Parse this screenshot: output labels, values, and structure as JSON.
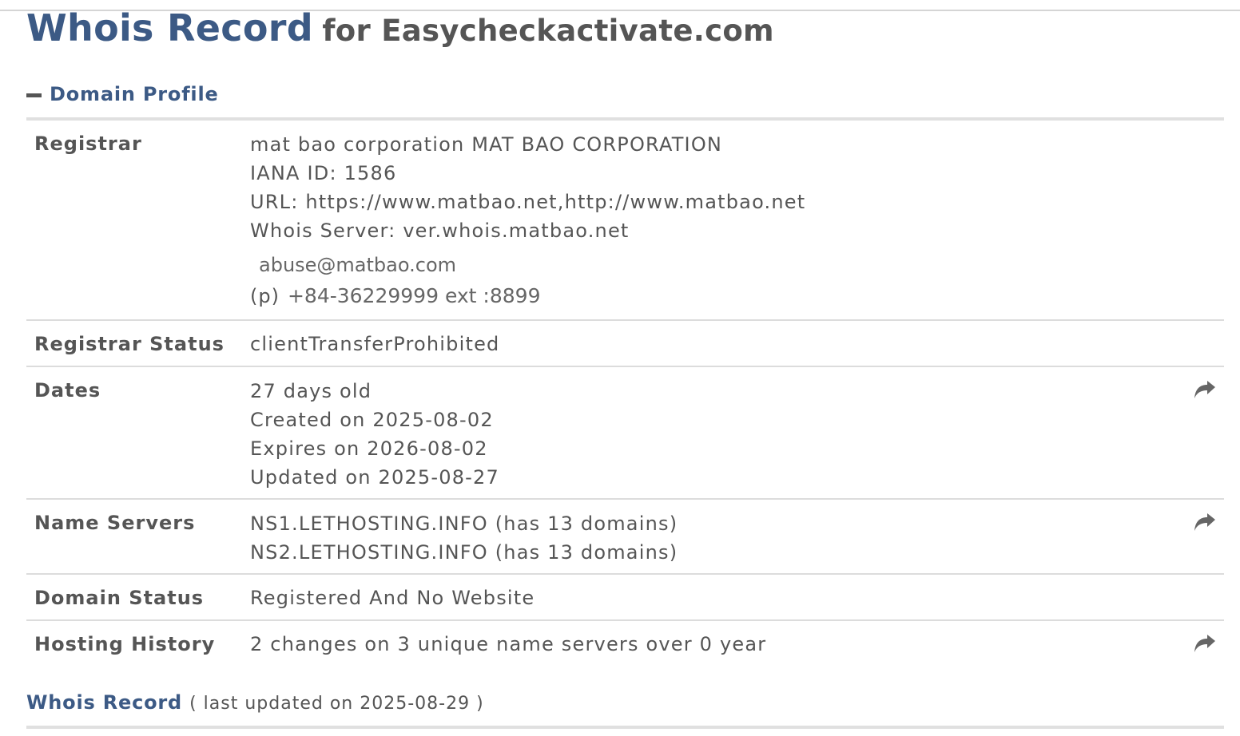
{
  "page": {
    "title_main": "Whois Record",
    "title_sub": "for Easycheckactivate.com"
  },
  "profile": {
    "section_title": "Domain Profile",
    "registrar": {
      "label": "Registrar",
      "name": "mat bao corporation MAT BAO CORPORATION",
      "iana": "IANA ID: 1586",
      "url": "URL: https://www.matbao.net,http://www.matbao.net",
      "whois_server": "Whois Server: ver.whois.matbao.net",
      "email": "abuse@matbao.com",
      "phone_label": "(p)",
      "phone": "+84-36229999 ext :8899"
    },
    "registrar_status": {
      "label": "Registrar Status",
      "value": "clientTransferProhibited"
    },
    "dates": {
      "label": "Dates",
      "age": "27 days old",
      "created": "Created on 2025-08-02",
      "expires": "Expires on 2026-08-02",
      "updated": "Updated on 2025-08-27"
    },
    "name_servers": {
      "label": "Name Servers",
      "ns1": "NS1.LETHOSTING.INFO (has 13 domains)",
      "ns2": "NS2.LETHOSTING.INFO (has 13 domains)"
    },
    "domain_status": {
      "label": "Domain Status",
      "value": "Registered And No Website"
    },
    "hosting_history": {
      "label": "Hosting History",
      "value": "2 changes on 3 unique name servers over 0 year"
    }
  },
  "whois_record": {
    "title": "Whois Record",
    "updated": "( last updated on 2025-08-29 )"
  },
  "icons": {
    "collapse": "minus-icon",
    "share": "share-arrow-icon"
  },
  "colors": {
    "heading_blue": "#3c5a85",
    "text_gray": "#555555",
    "rule_gray": "#dcdcdc"
  }
}
